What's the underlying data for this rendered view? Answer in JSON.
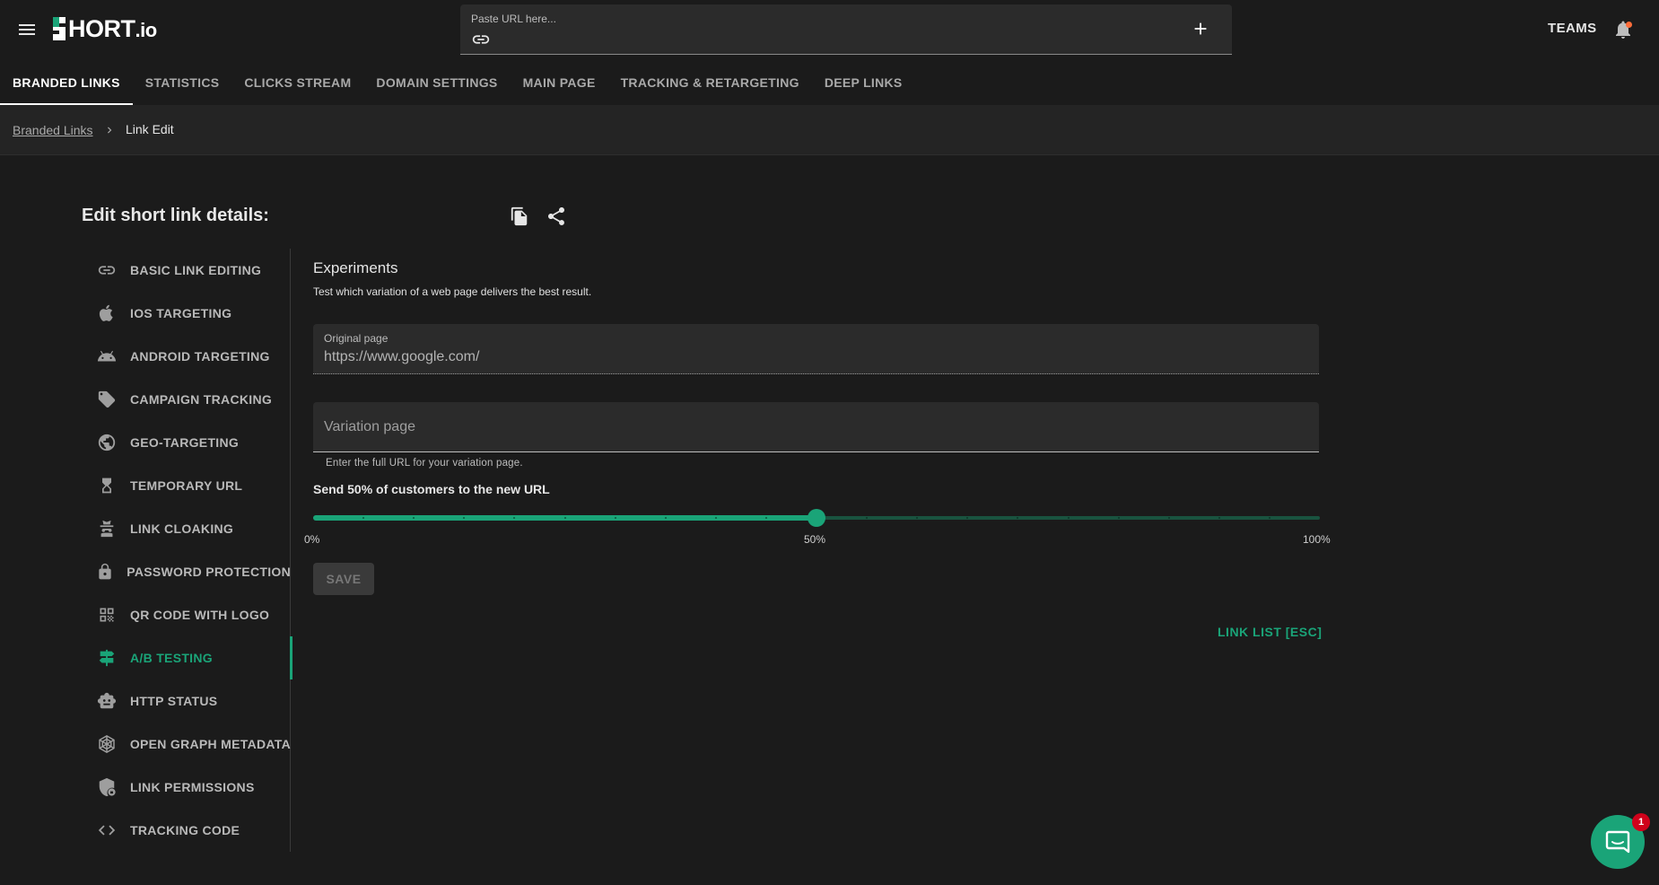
{
  "app": {
    "logo_text": "HORT",
    "logo_suffix": ".io"
  },
  "search": {
    "placeholder": "Paste URL here..."
  },
  "header": {
    "teams_label": "TEAMS"
  },
  "tabs": [
    {
      "label": "BRANDED LINKS"
    },
    {
      "label": "STATISTICS"
    },
    {
      "label": "CLICKS STREAM"
    },
    {
      "label": "DOMAIN SETTINGS"
    },
    {
      "label": "MAIN PAGE"
    },
    {
      "label": "TRACKING & RETARGETING"
    },
    {
      "label": "DEEP LINKS"
    }
  ],
  "breadcrumb": {
    "parent": "Branded Links",
    "current": "Link Edit"
  },
  "page": {
    "title": "Edit short link details:"
  },
  "sidebar": {
    "items": [
      {
        "label": "BASIC LINK EDITING",
        "icon": "link-icon"
      },
      {
        "label": "IOS TARGETING",
        "icon": "apple-icon"
      },
      {
        "label": "ANDROID TARGETING",
        "icon": "android-icon"
      },
      {
        "label": "CAMPAIGN TRACKING",
        "icon": "tag-icon"
      },
      {
        "label": "GEO-TARGETING",
        "icon": "globe-icon"
      },
      {
        "label": "TEMPORARY URL",
        "icon": "hourglass-icon"
      },
      {
        "label": "LINK CLOAKING",
        "icon": "spy-icon"
      },
      {
        "label": "PASSWORD PROTECTION",
        "icon": "lock-icon"
      },
      {
        "label": "QR CODE WITH LOGO",
        "icon": "qr-code-icon"
      },
      {
        "label": "A/B TESTING",
        "icon": "signpost-icon",
        "active": true
      },
      {
        "label": "HTTP STATUS",
        "icon": "robot-icon"
      },
      {
        "label": "OPEN GRAPH METADATA",
        "icon": "graph-icon"
      },
      {
        "label": "LINK PERMISSIONS",
        "icon": "shield-lock-icon"
      },
      {
        "label": "TRACKING CODE",
        "icon": "code-icon"
      }
    ]
  },
  "experiment": {
    "title": "Experiments",
    "subtitle": "Test which variation of a web page delivers the best result.",
    "original_label": "Original page",
    "original_value": "https://www.google.com/",
    "variation_placeholder": "Variation page",
    "variation_hint": "Enter the full URL for your variation page.",
    "slider_label": "Send 50% of customers to the new URL",
    "slider_value_percent": 50,
    "slider_min_label": "0%",
    "slider_mid_label": "50%",
    "slider_max_label": "100%",
    "save_label": "SAVE",
    "link_list_label": "LINK LIST [ESC]"
  },
  "chat": {
    "badge_count": "1"
  },
  "colors": {
    "accent": "#1aa478",
    "background": "#1b1b1b",
    "field": "#2b2b2b",
    "notification": "#ff6d3a",
    "badge": "#d0021b"
  }
}
